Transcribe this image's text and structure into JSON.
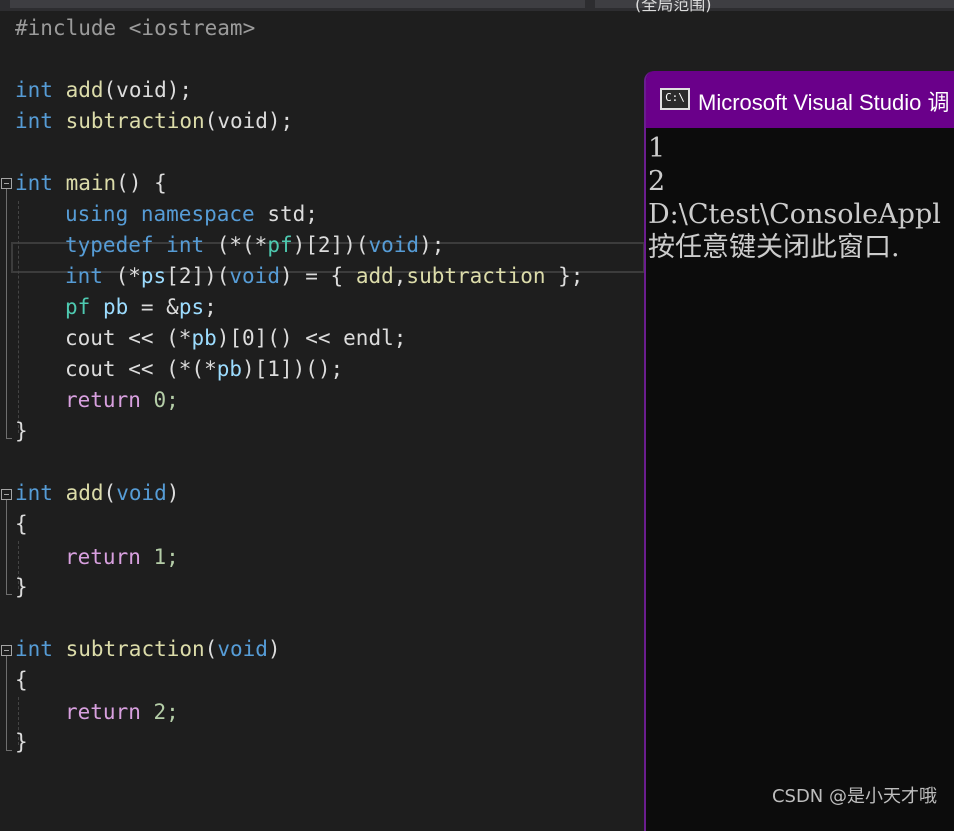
{
  "topbar": {
    "right_label": "(全局范围)"
  },
  "code": {
    "include": "#include <iostream>",
    "decl_add_kw": "int",
    "decl_add_fn": "add",
    "decl_add_rest": "(void);",
    "decl_sub_kw": "int",
    "decl_sub_fn": "subtraction",
    "decl_sub_rest": "(void);",
    "main_kw": "int",
    "main_fn": "main",
    "main_rest": "() {",
    "using": "using",
    "namespace": "namespace",
    "std": " std;",
    "typedef_kw": "typedef",
    "typedef_int": "int",
    "typedef_p1": " (*(*",
    "typedef_pf": "pf",
    "typedef_p2": ")[2])(",
    "typedef_void": "void",
    "typedef_p3": ");",
    "ps_int": "int",
    "ps_p1": " (*",
    "ps_ps": "ps",
    "ps_p2": "[2])(",
    "ps_void": "void",
    "ps_p3": ") = { ",
    "ps_add": "add",
    "ps_comma": ",",
    "ps_sub": "subtraction",
    "ps_p4": " };",
    "pf_ty": "pf",
    "pb_var": " pb",
    "pb_rest1": " = &",
    "pb_ps": "ps",
    "pb_rest2": ";",
    "cout1_a": "cout << (*",
    "cout1_pb": "pb",
    "cout1_b": ")[0]() << endl;",
    "cout2_a": "cout << (*(*",
    "cout2_pb": "pb",
    "cout2_b": ")[1])();",
    "ret_kw": "return",
    "ret0": " 0;",
    "close": "}",
    "add_def_kw": "int",
    "add_def_fn": "add",
    "add_def_p": "(",
    "add_def_void": "void",
    "add_def_p2": ")",
    "open": "{",
    "ret1": " 1;",
    "sub_def_kw": "int",
    "sub_def_fn": "subtraction",
    "sub_def_p": "(",
    "sub_def_void": "void",
    "sub_def_p2": ")",
    "ret2": " 2;"
  },
  "console": {
    "title": "Microsoft Visual Studio 调",
    "icon_text": "C:\\",
    "lines": [
      "1",
      "2",
      "D:\\Ctest\\ConsoleAppl",
      "按任意键关闭此窗口."
    ]
  },
  "watermark": "CSDN @是小天才哦"
}
